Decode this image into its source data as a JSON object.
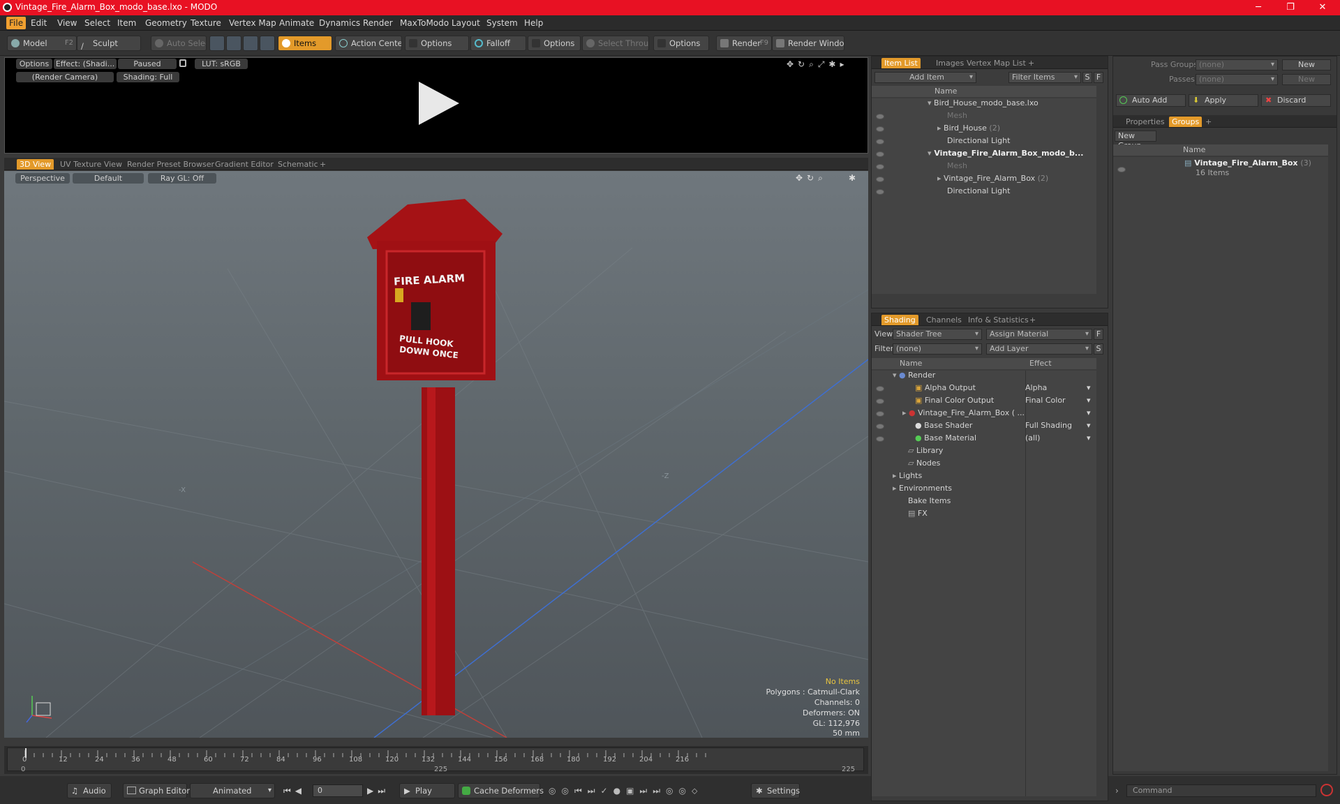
{
  "window": {
    "title": "Vintage_Fire_Alarm_Box_modo_base.lxo - MODO",
    "min": "─",
    "max": "❐",
    "close": "✕"
  },
  "menu": [
    "File",
    "Edit",
    "View",
    "Select",
    "Item",
    "Geometry",
    "Texture",
    "Vertex Map",
    "Animate",
    "Dynamics",
    "Render",
    "MaxToModo",
    "Layout",
    "System",
    "Help"
  ],
  "toolbar": {
    "model": "Model",
    "model_key": "F2",
    "sculpt": "Sculpt",
    "auto_select": "Auto Select",
    "items": "Items",
    "action_center": "Action Center",
    "options1": "Options",
    "falloff": "Falloff",
    "options2": "Options",
    "select_through": "Select Through",
    "options3": "Options",
    "render": "Render",
    "render_key": "F9",
    "render_window": "Render Window"
  },
  "render_view": {
    "options": "Options",
    "effect": "Effect: (Shadi...",
    "paused": "Paused",
    "lut": "LUT: sRGB",
    "camera": "(Render Camera)",
    "shading": "Shading: Full"
  },
  "viewport_tabs": [
    "3D View",
    "UV Texture View",
    "Render Preset Browser",
    "Gradient Editor",
    "Schematic",
    "+"
  ],
  "viewport": {
    "perspective": "Perspective",
    "default": "Default",
    "raygl": "Ray GL: Off",
    "axis_x": "-X",
    "axis_z": "-Z",
    "sign_title": "FIRE ALARM",
    "sign_line1": "PULL  HOOK",
    "sign_line2": "DOWN ONCE",
    "info": [
      "No Items",
      "Polygons : Catmull-Clark",
      "Channels: 0",
      "Deformers: ON",
      "GL: 112,976",
      "50 mm"
    ]
  },
  "timeline": {
    "ticks": [
      "0",
      "12",
      "24",
      "36",
      "48",
      "60",
      "72",
      "84",
      "96",
      "108",
      "120",
      "132",
      "144",
      "156",
      "168",
      "180",
      "192",
      "204",
      "216"
    ],
    "start": "0",
    "end": "225",
    "mid": "225"
  },
  "bottom": {
    "audio": "Audio",
    "graph_editor": "Graph Editor",
    "animated": "Animated",
    "frame": "0",
    "play": "Play",
    "cache": "Cache Deformers",
    "settings": "Settings",
    "command": "Command"
  },
  "item_list": {
    "tabs": [
      "Item List",
      "Images",
      "Vertex Map List",
      "+"
    ],
    "add_item": "Add Item",
    "filter": "Filter Items",
    "s": "S",
    "f": "F",
    "col_name": "Name",
    "rows": [
      {
        "label": "Bird_House_modo_base.lxo",
        "bold": false,
        "dim": false,
        "count": ""
      },
      {
        "label": "Mesh",
        "bold": false,
        "dim": true,
        "count": ""
      },
      {
        "label": "Bird_House",
        "bold": false,
        "dim": false,
        "count": "(2)"
      },
      {
        "label": "Directional Light",
        "bold": false,
        "dim": false,
        "count": ""
      },
      {
        "label": "Vintage_Fire_Alarm_Box_modo_b...",
        "bold": true,
        "dim": false,
        "count": ""
      },
      {
        "label": "Mesh",
        "bold": false,
        "dim": true,
        "count": ""
      },
      {
        "label": "Vintage_Fire_Alarm_Box",
        "bold": false,
        "dim": false,
        "count": "(2)"
      },
      {
        "label": "Directional Light",
        "bold": false,
        "dim": false,
        "count": ""
      }
    ]
  },
  "shading": {
    "tabs": [
      "Shading",
      "Channels",
      "Info & Statistics",
      "+"
    ],
    "view_label": "View",
    "view_value": "Shader Tree",
    "assign": "Assign Material",
    "f": "F",
    "filter_label": "Filter",
    "filter_value": "(none)",
    "add_layer": "Add Layer",
    "s": "S",
    "col_name": "Name",
    "col_effect": "Effect",
    "rows": [
      {
        "label": "Render",
        "effect": ""
      },
      {
        "label": "Alpha Output",
        "effect": "Alpha"
      },
      {
        "label": "Final Color Output",
        "effect": "Final Color"
      },
      {
        "label": "Vintage_Fire_Alarm_Box ( ...",
        "effect": ""
      },
      {
        "label": "Base Shader",
        "effect": "Full Shading"
      },
      {
        "label": "Base Material",
        "effect": "(all)"
      },
      {
        "label": "Library",
        "effect": ""
      },
      {
        "label": "Nodes",
        "effect": ""
      },
      {
        "label": "Lights",
        "effect": ""
      },
      {
        "label": "Environments",
        "effect": ""
      },
      {
        "label": "Bake Items",
        "effect": ""
      },
      {
        "label": "FX",
        "effect": ""
      }
    ]
  },
  "groups": {
    "pass_groups": "Pass Groups",
    "passes": "Passes",
    "none": "(none)",
    "new": "New",
    "auto_add": "Auto Add",
    "apply": "Apply",
    "discard": "Discard",
    "tabs": [
      "Properties",
      "Groups",
      "+"
    ],
    "new_group": "New Group",
    "col_name": "Name",
    "group_name": "Vintage_Fire_Alarm_Box",
    "group_count": "(3)",
    "group_items": "16 Items"
  }
}
